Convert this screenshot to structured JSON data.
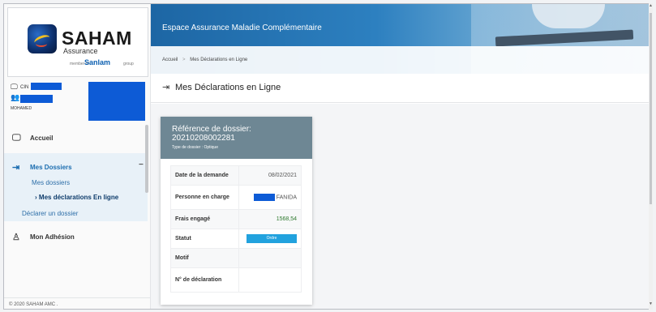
{
  "logo": {
    "name": "SAHAM",
    "subtitle": "Assurance",
    "member_text": "member of",
    "group_brand": "Sanlam",
    "group_text": "group"
  },
  "profile": {
    "card_prefix": "CIN",
    "name": "MOHAMED"
  },
  "nav": {
    "home": "Accueil",
    "dossiers": "Mes Dossiers",
    "collapse": "−",
    "sub_items": [
      "Mes dossiers",
      "Mes déclarations En ligne",
      "Déclarer un dossier"
    ],
    "active_marker": "›",
    "adhesion": "Mon Adhésion"
  },
  "footer": {
    "text": "© 2020 SAHAM AMC ."
  },
  "banner": {
    "title": "Espace Assurance Maladie Complémentaire"
  },
  "breadcrumb": {
    "home": "Accueil",
    "separator": ">",
    "current": "Mes Déclarations en Ligne"
  },
  "page": {
    "title": "Mes Déclarations en Ligne"
  },
  "card": {
    "ref_label": "Référence de dossier:",
    "ref_number": "20210208002281",
    "type": "Type de dossier : Optique",
    "rows": {
      "date_label": "Date de la demande",
      "date_value": "08/02/2021",
      "person_label": "Personne en charge",
      "person_value": "FANIDA",
      "fees_label": "Frais engagé",
      "fees_value": "1568,54",
      "status_label": "Statut",
      "status_value": "Ordre",
      "motif_label": "Motif",
      "motif_value": "",
      "decl_label": "N° de déclaration",
      "decl_value": ""
    }
  },
  "colors": {
    "banner": "#2d80c0",
    "card_header": "#6e8794",
    "status_pill": "#22a2de",
    "active_nav_bg": "#e8f1f8",
    "redaction": "#0d5bd6"
  },
  "icons": [
    "id-card-icon",
    "users-icon",
    "monitor-icon",
    "folder-login-icon",
    "user-icon",
    "chevron-right-icon",
    "minus-icon"
  ]
}
